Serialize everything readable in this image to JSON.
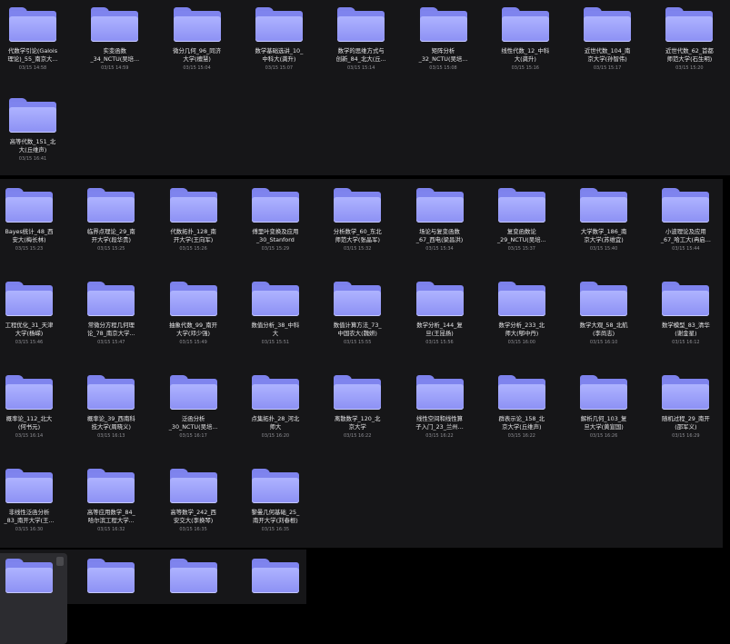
{
  "panels": [
    {
      "items": [
        {
          "name": "代数学引论(Galois\n理论)_55_南京大...",
          "date": "03/15 14:58"
        },
        {
          "name": "实变函数\n_34_NCTU(吴培...",
          "date": "03/15 14:59"
        },
        {
          "name": "微分几何_96_同济\n大学(檀慧)",
          "date": "03/15 15:04"
        },
        {
          "name": "数学基础选讲_10_\n中科大(龚升)",
          "date": "03/15 15:07"
        },
        {
          "name": "数学的思维方式与\n创新_84_北大(丘...",
          "date": "03/15 15:14"
        },
        {
          "name": "矩阵分析\n_32_NCTU(吴培...",
          "date": "03/15 15:08"
        },
        {
          "name": "线性代数_12_中科\n大(龚升)",
          "date": "03/15 15:16"
        },
        {
          "name": "近世代数_104_南\n京大学(孙智伟)",
          "date": "03/15 15:17"
        },
        {
          "name": "近世代数_62_首都\n师范大学(石生明)",
          "date": "03/15 15:20"
        },
        {
          "name": "高等代数_151_北\n大(丘维声)",
          "date": "03/15 16:41"
        }
      ]
    },
    {
      "items": [
        {
          "name": "Bayes统计_48_西\n安大(梅长林)",
          "date": "03/15 15:23"
        },
        {
          "name": "临界点理论_29_南\n开大学(段华贵)",
          "date": "03/15 15:25"
        },
        {
          "name": "代数拓扑_128_南\n开大学(王向军)",
          "date": "03/15 15:26"
        },
        {
          "name": "傅里叶变换及应用\n_30_Stanford",
          "date": "03/15 15:29"
        },
        {
          "name": "分析数学_60_东北\n师范大学(张晶军)",
          "date": "03/15 15:32"
        },
        {
          "name": "场论与复变函数\n_67_西电(梁昌洪)",
          "date": "03/15 15:34"
        },
        {
          "name": "复变函数论\n_29_NCTU(吴培...",
          "date": "03/15 15:37"
        },
        {
          "name": "大学数学_186_南\n京大学(苏维宜)",
          "date": "03/15 15:40"
        },
        {
          "name": "小波理论及应用\n_67_哈工大(冉启...",
          "date": "03/15 15:44"
        },
        {
          "name": "工程优化_31_天津\n大学(杨嵘)",
          "date": "03/15 15:46"
        },
        {
          "name": "常微分方程几何理\n论_78_南京大学...",
          "date": "03/15 15:47"
        },
        {
          "name": "抽象代数_99_南开\n大学(邓少强)",
          "date": "03/15 15:49"
        },
        {
          "name": "数值分析_38_中科\n大",
          "date": "03/15 15:51"
        },
        {
          "name": "数值计算方法_73_\n中国农大(魏妍)",
          "date": "03/15 15:55"
        },
        {
          "name": "数学分析_144_复\n旦(王昆扬)",
          "date": "03/15 15:56"
        },
        {
          "name": "数学分析_233_北\n师大(郇中丹)",
          "date": "03/15 16:00"
        },
        {
          "name": "数学大观_58_北航\n(李尚志)",
          "date": "03/15 16:10"
        },
        {
          "name": "数学模型_83_清华\n(谢金星)",
          "date": "03/15 16:12"
        },
        {
          "name": "概率论_112_北大\n(何书元)",
          "date": "03/15 16:14"
        },
        {
          "name": "概率论_39_西南科\n技大学(周晓义)",
          "date": "03/15 16:13"
        },
        {
          "name": "泛函分析\n_30_NCTU(吴培...",
          "date": "03/15 16:17"
        },
        {
          "name": "点集拓扑_28_河北\n师大",
          "date": "03/15 16:20"
        },
        {
          "name": "离散数学_120_北\n京大学",
          "date": "03/15 16:22"
        },
        {
          "name": "线性空间和线性算\n子入门_23_兰州...",
          "date": "03/15 16:22"
        },
        {
          "name": "群表示论_158_北\n京大学(丘维声)",
          "date": "03/15 16:22"
        },
        {
          "name": "解析几何_103_复\n旦大学(黄宣国)",
          "date": "03/15 16:26"
        },
        {
          "name": "随机过程_29_南开\n(邵军义)",
          "date": "03/15 16:29"
        },
        {
          "name": "非线性泛函分析\n_83_南开大学(王...",
          "date": "03/15 16:30"
        },
        {
          "name": "高等应用数学_84_\n哈尔滨工程大学...",
          "date": "03/15 16:32"
        },
        {
          "name": "高等数学_242_西\n安交大(李换琴)",
          "date": "03/15 16:35"
        },
        {
          "name": "黎曼几何基础_25_\n南开大学(刘春根)",
          "date": "03/15 16:35"
        }
      ]
    },
    {
      "items": [
        {
          "name": "",
          "date": ""
        },
        {
          "name": "",
          "date": ""
        },
        {
          "name": "",
          "date": ""
        },
        {
          "name": "",
          "date": ""
        }
      ]
    }
  ],
  "colors": {
    "background": "#000000",
    "panel": "#161618",
    "folder_front": "#aeb3ff",
    "folder_back": "#7f84ee",
    "text": "#e8e8ea",
    "date_text": "#8e8e93"
  },
  "icons": {
    "folder": "folder-icon"
  }
}
